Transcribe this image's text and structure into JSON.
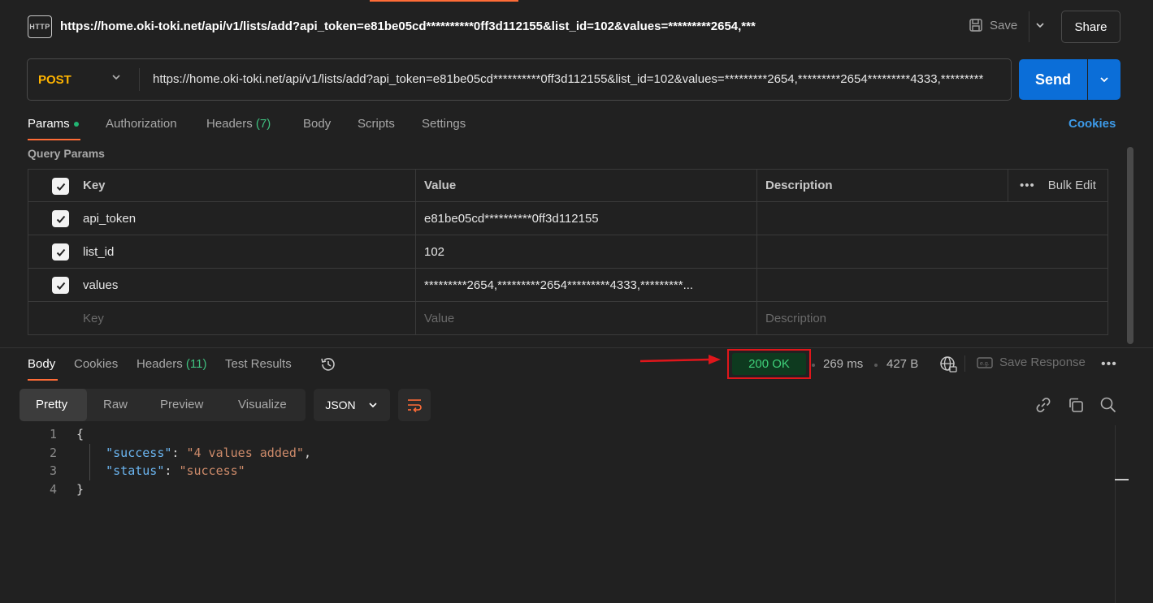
{
  "request": {
    "icon": "http-icon",
    "title": "https://home.oki-toki.net/api/v1/lists/add?api_token=e81be05cd**********0ff3d112155&list_id=102&values=*********2654,***",
    "save_label": "Save",
    "share_label": "Share",
    "method": "POST",
    "url": "https://home.oki-toki.net/api/v1/lists/add?api_token=e81be05cd**********0ff3d112155&list_id=102&values=*********2654,*********2654*********4333,*********",
    "send_label": "Send"
  },
  "request_tabs": {
    "params": "Params",
    "authorization": "Authorization",
    "headers": "Headers",
    "headers_count": "(7)",
    "body": "Body",
    "scripts": "Scripts",
    "settings": "Settings",
    "cookies": "Cookies"
  },
  "query_params": {
    "label": "Query Params",
    "columns": {
      "key": "Key",
      "value": "Value",
      "description": "Description",
      "bulk_edit": "Bulk Edit"
    },
    "rows": [
      {
        "key": "api_token",
        "value": "e81be05cd**********0ff3d112155",
        "checked": true
      },
      {
        "key": "list_id",
        "value": "102",
        "checked": true
      },
      {
        "key": "values",
        "value": "*********2654,*********2654*********4333,*********...",
        "checked": true
      }
    ],
    "placeholders": {
      "key": "Key",
      "value": "Value",
      "description": "Description"
    }
  },
  "response_tabs": {
    "body": "Body",
    "cookies": "Cookies",
    "headers": "Headers",
    "headers_count": "(11)",
    "test_results": "Test Results"
  },
  "response_meta": {
    "status": "200 OK",
    "time": "269 ms",
    "size": "427 B",
    "save_response": "Save Response"
  },
  "view": {
    "modes": [
      "Pretty",
      "Raw",
      "Preview",
      "Visualize"
    ],
    "active_mode": "Pretty",
    "format": "JSON"
  },
  "code": {
    "l1": "1",
    "l2": "2",
    "l3": "3",
    "l4": "4",
    "open": "{",
    "k1": "\"success\"",
    "v1": "\"4 values added\"",
    "k2": "\"status\"",
    "v2": "\"success\"",
    "close": "}"
  },
  "colors": {
    "accent": "#ff6c37",
    "send": "#0b6ed8",
    "method": "#ffb400",
    "status_ok": "#3fd17a",
    "highlight_box": "#e0161b"
  }
}
